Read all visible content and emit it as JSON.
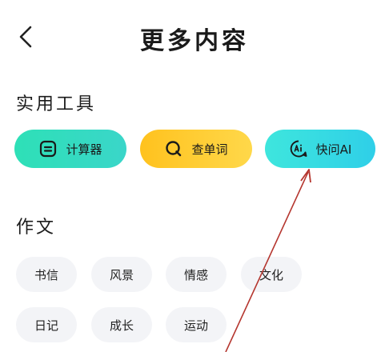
{
  "header": {
    "title": "更多内容"
  },
  "tools_section": {
    "title": "实用工具",
    "items": [
      {
        "label": "计算器",
        "icon": "calculator-icon"
      },
      {
        "label": "查单词",
        "icon": "search-icon"
      },
      {
        "label": "快问AI",
        "icon": "ai-icon"
      }
    ]
  },
  "essay_section": {
    "title": "作文",
    "items": [
      {
        "label": "书信"
      },
      {
        "label": "风景"
      },
      {
        "label": "情感"
      },
      {
        "label": "文化"
      },
      {
        "label": "日记"
      },
      {
        "label": "成长"
      },
      {
        "label": "运动"
      }
    ]
  },
  "colors": {
    "calc": "#2ee0b7",
    "dict": "#ffc21e",
    "ai": "#2fcfe8",
    "chip_bg": "#f3f4f7",
    "annotation": "#b5362f"
  }
}
